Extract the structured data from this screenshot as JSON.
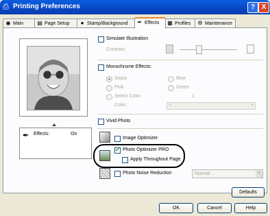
{
  "window": {
    "title": "Printing Preferences",
    "help": "?",
    "close": "X"
  },
  "tabs": [
    {
      "label": "Main",
      "icon": "main-icon"
    },
    {
      "label": "Page Setup",
      "icon": "page-setup-icon"
    },
    {
      "label": "Stamp/Background",
      "icon": "stamp-icon"
    },
    {
      "label": "Effects",
      "icon": "effects-icon"
    },
    {
      "label": "Profiles",
      "icon": "profiles-icon"
    },
    {
      "label": "Maintenance",
      "icon": "maintenance-icon"
    }
  ],
  "active_tab": "Effects",
  "info": {
    "label": "Effects:",
    "value": "On"
  },
  "simulate": {
    "label": "Simulate Illustration",
    "checked": false,
    "contrast_label": "Contrast:"
  },
  "monochrome": {
    "label": "Monochrome Effects:",
    "checked": false,
    "options": {
      "sepia": "Sepia",
      "blue": "Blue",
      "pink": "Pink",
      "green": "Green",
      "select_color": "Select Color"
    },
    "selected": "Sepia",
    "color_label": "Color:",
    "color_value": "1"
  },
  "vivid": {
    "label": "Vivid Photo",
    "checked": false
  },
  "image_optimizer": {
    "label": "Image Optimizer",
    "checked": false
  },
  "photo_optimizer": {
    "label": "Photo Optimizer PRO",
    "checked": true
  },
  "apply_throughout": {
    "label": "Apply Throughout Page",
    "checked": false
  },
  "noise": {
    "label": "Photo Noise Reduction",
    "checked": false,
    "level": "Normal"
  },
  "buttons": {
    "defaults": "Defaults",
    "ok": "OK",
    "cancel": "Cancel",
    "help": "Help"
  }
}
